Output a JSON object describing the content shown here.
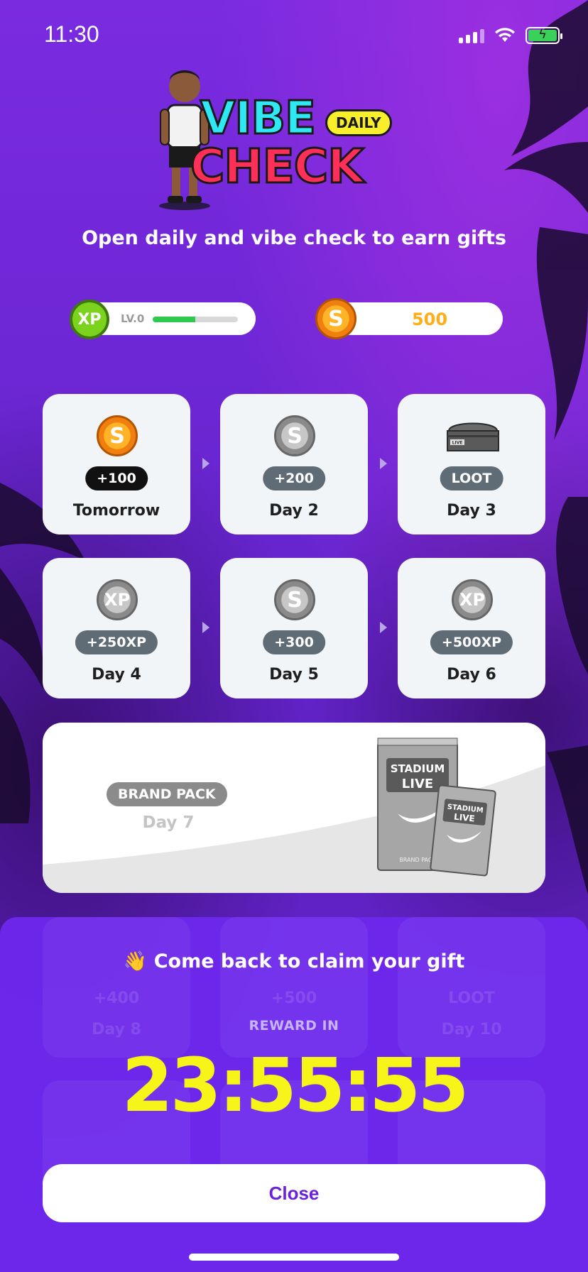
{
  "status_bar": {
    "time": "11:30"
  },
  "logo": {
    "line1": "VIBE",
    "line2": "CHECK",
    "badge": "DAILY"
  },
  "subtitle": "Open daily and vibe check to earn gifts",
  "stats": {
    "xp_icon": "XP",
    "level": "LV.0",
    "level_progress": 0.5,
    "coins": "500"
  },
  "days": [
    {
      "reward": "+100",
      "label": "Tomorrow",
      "icon": "coin-gold-icon",
      "coin_text": "S"
    },
    {
      "reward": "+200",
      "label": "Day 2",
      "icon": "coin-silver-icon",
      "coin_text": "S"
    },
    {
      "reward": "LOOT",
      "label": "Day 3",
      "icon": "chest-icon",
      "chest_text": "LIVE"
    },
    {
      "reward": "+250XP",
      "label": "Day 4",
      "icon": "xp-coin-icon",
      "coin_text": "XP"
    },
    {
      "reward": "+300",
      "label": "Day 5",
      "icon": "coin-silver-icon",
      "coin_text": "S"
    },
    {
      "reward": "+500XP",
      "label": "Day 6",
      "icon": "xp-coin-icon",
      "coin_text": "XP"
    }
  ],
  "day7": {
    "reward": "BRAND PACK",
    "label": "Day 7",
    "pack_line1": "STADIUM",
    "pack_line2": "LIVE",
    "pack_footer": "BRAND PACK"
  },
  "hidden_days": [
    {
      "reward": "+400",
      "label": "Day 8"
    },
    {
      "reward": "+500",
      "label": "Day 9"
    },
    {
      "reward": "LOOT",
      "label": "Day 10"
    }
  ],
  "panel": {
    "emoji": "👋",
    "message": "Come back to claim your gift",
    "reward_in": "REWARD IN",
    "timer": "23:55:55",
    "close_label": "Close"
  },
  "colors": {
    "background": "#6a22cf",
    "timer": "#f6f418",
    "close_text": "#6a21d9",
    "coin_gold": "#ffae1a",
    "xp_green": "#7cd31e"
  }
}
